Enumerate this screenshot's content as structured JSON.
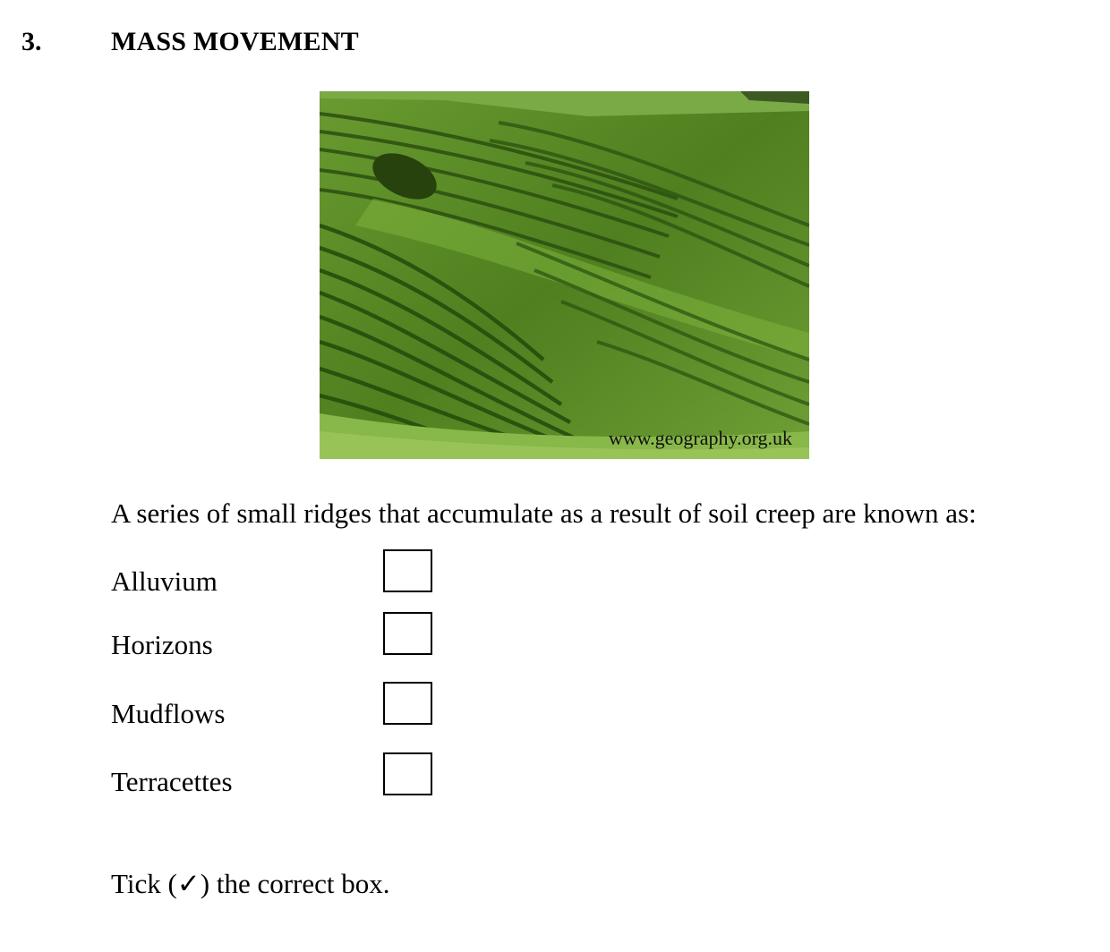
{
  "question": {
    "number": "3.",
    "title": "MASS MOVEMENT",
    "image": {
      "subject": "terracettes-hillside-photo",
      "watermark": "www.geography.org.uk"
    },
    "prompt": "A series of small ridges that accumulate as a result of soil creep are known as:",
    "options": [
      {
        "label": "Alluvium",
        "checked": false
      },
      {
        "label": "Horizons",
        "checked": false
      },
      {
        "label": "Mudflows",
        "checked": false
      },
      {
        "label": "Terracettes",
        "checked": false
      }
    ],
    "instruction": "Tick (✓) the correct box."
  },
  "colors": {
    "grass_dark": "#2f5a12",
    "grass_mid": "#5f8f2a",
    "grass_light": "#8fbf45"
  }
}
